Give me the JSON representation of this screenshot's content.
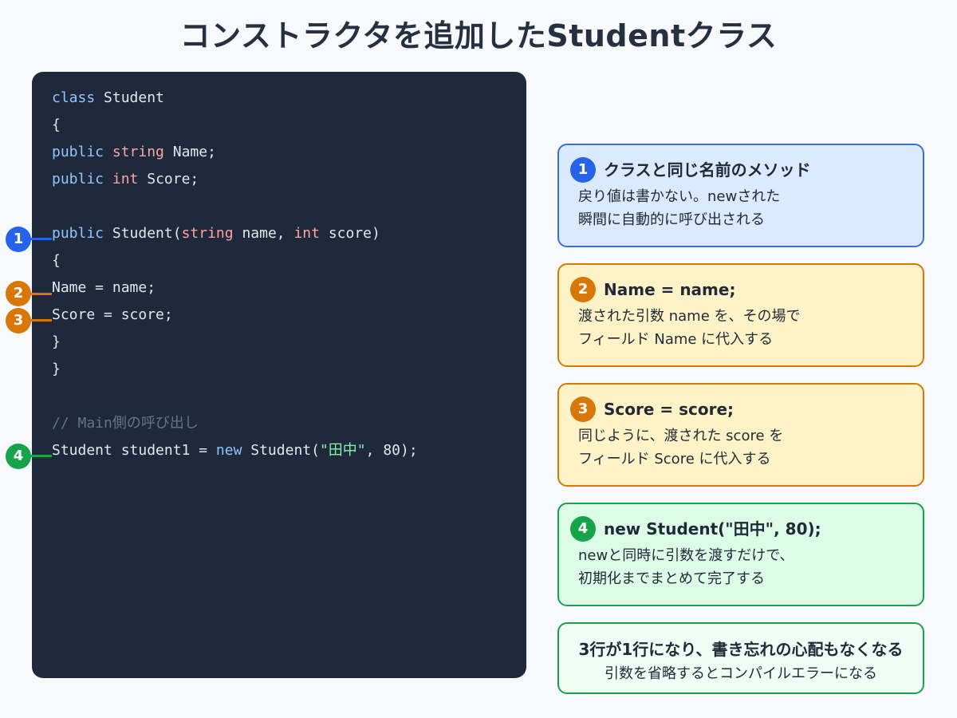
{
  "title": "コンストラクタを追加したStudentクラス",
  "code": {
    "l1": {
      "kw": "class",
      "rest": " Student"
    },
    "l2": "{",
    "l3": {
      "kw": "public",
      "type": "string",
      "rest": " Name;"
    },
    "l4": {
      "kw": "public",
      "type": "int",
      "rest": " Score;"
    },
    "l5": {
      "kw": "public",
      "name": " Student(",
      "type1": "string",
      "mid": " name, ",
      "type2": "int",
      "rest": " score)"
    },
    "l6": "{",
    "l7": "Name = name;",
    "l8": "Score = score;",
    "l9": "}",
    "l10": "}",
    "l11": "// Main側の呼び出し",
    "l12": {
      "pre": "Student student1 = ",
      "kw": "new",
      "mid": " Student(",
      "str": "\"田中\"",
      "rest": ", 80);"
    }
  },
  "markers": [
    "1",
    "2",
    "3",
    "4"
  ],
  "cards": [
    {
      "badge": "1",
      "title": "クラスと同じ名前のメソッド",
      "line1": "戻り値は書かない。newされた",
      "line2": "瞬間に自動的に呼び出される"
    },
    {
      "badge": "2",
      "title": "Name = name;",
      "line1": "渡された引数 name を、その場で",
      "line2": "フィールド Name に代入する"
    },
    {
      "badge": "3",
      "title": "Score = score;",
      "line1": "同じように、渡された score を",
      "line2": "フィールド Score に代入する"
    },
    {
      "badge": "4",
      "title": "new Student(\"田中\", 80);",
      "line1": "newと同時に引数を渡すだけで、",
      "line2": "初期化までまとめて完了する"
    }
  ],
  "summary": {
    "main": "3行が1行になり、書き忘れの心配もなくなる",
    "sub": "引数を省略するとコンパイルエラーになる"
  },
  "colors": {
    "blue": "#2563eb",
    "orange": "#d97706",
    "green": "#16a34a",
    "card_blue_bg": "#dbeafe",
    "card_yellow_bg": "#fef3c7",
    "card_green_bg": "#dcfce7"
  }
}
